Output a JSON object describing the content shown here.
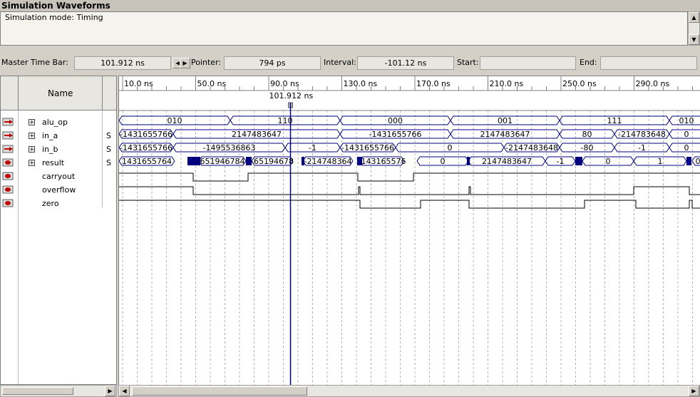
{
  "window": {
    "title": "Simulation Waveforms"
  },
  "mode": {
    "text": "Simulation mode: Timing"
  },
  "timebar": {
    "master_label": "Master Time Bar:",
    "master_value": "101.912 ns",
    "pointer_label": "Pointer:",
    "pointer_value": "794 ps",
    "interval_label": "Interval:",
    "interval_value": "-101.12 ns",
    "start_label": "Start:",
    "start_value": "",
    "end_label": "End:",
    "end_value": ""
  },
  "header": {
    "name_label": "Name"
  },
  "cursor_label": "101.912 ns",
  "time_ticks": [
    "10.0 ns",
    "50.0 ns",
    "90.0 ns",
    "130.0 ns",
    "170.0 ns",
    "210.0 ns",
    "250.0 ns",
    "290.0 ns"
  ],
  "signals": [
    {
      "name": "alu_op",
      "radix": "",
      "expandable": true,
      "icon": "input-icon"
    },
    {
      "name": "in_a",
      "radix": "S",
      "expandable": true,
      "icon": "input-icon"
    },
    {
      "name": "in_b",
      "radix": "S",
      "expandable": true,
      "icon": "input-icon"
    },
    {
      "name": "result",
      "radix": "S",
      "expandable": true,
      "icon": "output-icon"
    },
    {
      "name": "carryout",
      "radix": "",
      "expandable": false,
      "icon": "output-icon"
    },
    {
      "name": "overflow",
      "radix": "",
      "expandable": false,
      "icon": "output-icon"
    },
    {
      "name": "zero",
      "radix": "",
      "expandable": false,
      "icon": "output-icon"
    }
  ],
  "bus_values": {
    "alu_op": [
      "010",
      "110",
      "000",
      "001",
      "111",
      "010"
    ],
    "in_a": [
      "-1431655766",
      "2147483647",
      "-1431655766",
      "2147483647",
      "80",
      "-214783648",
      "0"
    ],
    "in_b": [
      "-1431655766",
      "-1495536863",
      "-1",
      "-1431655766",
      "0",
      "-2147483648",
      "-80",
      "-1",
      "0"
    ],
    "result": [
      "1431655764",
      "651946784",
      "-65194678",
      "-214748364",
      "-143165576",
      "0",
      "2147483647",
      "-1",
      "0",
      "1",
      "0"
    ]
  },
  "colors": {
    "wave": "#000080",
    "cursor": "#000080",
    "grid": "#808080"
  }
}
